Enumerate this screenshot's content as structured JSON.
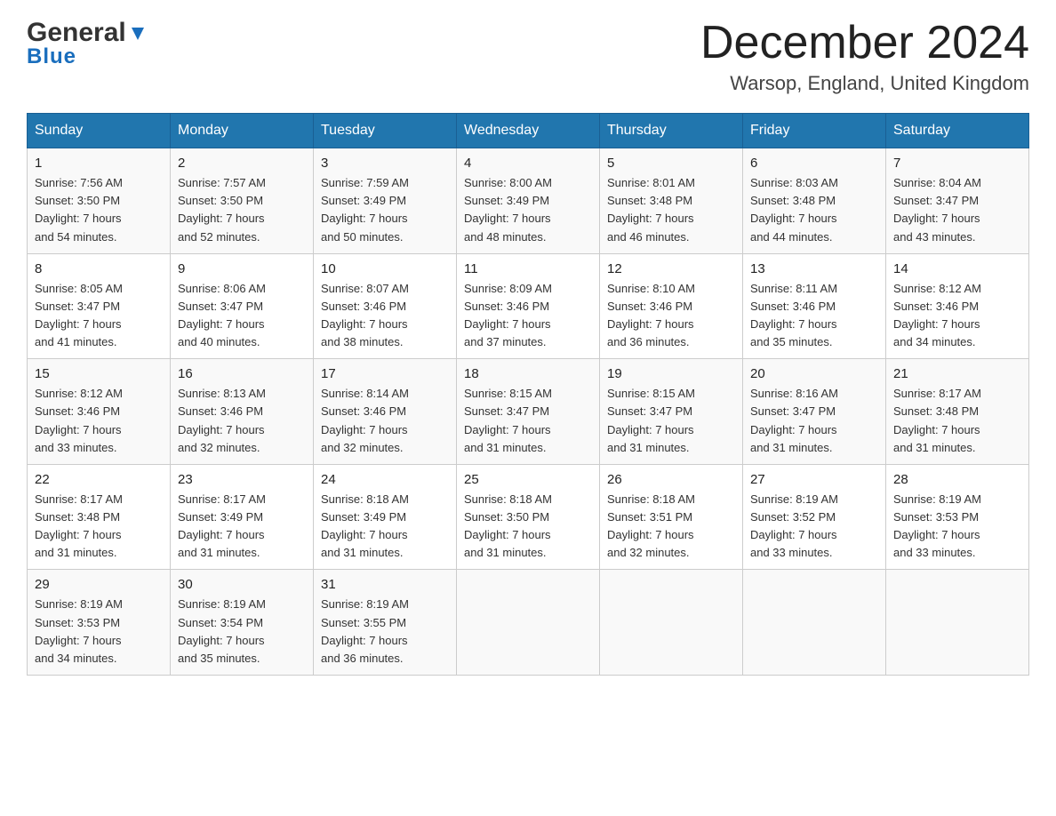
{
  "header": {
    "logo_general": "General",
    "logo_blue": "Blue",
    "month_title": "December 2024",
    "location": "Warsop, England, United Kingdom"
  },
  "weekdays": [
    "Sunday",
    "Monday",
    "Tuesday",
    "Wednesday",
    "Thursday",
    "Friday",
    "Saturday"
  ],
  "weeks": [
    [
      {
        "day": "1",
        "sunrise": "7:56 AM",
        "sunset": "3:50 PM",
        "daylight": "7 hours and 54 minutes."
      },
      {
        "day": "2",
        "sunrise": "7:57 AM",
        "sunset": "3:50 PM",
        "daylight": "7 hours and 52 minutes."
      },
      {
        "day": "3",
        "sunrise": "7:59 AM",
        "sunset": "3:49 PM",
        "daylight": "7 hours and 50 minutes."
      },
      {
        "day": "4",
        "sunrise": "8:00 AM",
        "sunset": "3:49 PM",
        "daylight": "7 hours and 48 minutes."
      },
      {
        "day": "5",
        "sunrise": "8:01 AM",
        "sunset": "3:48 PM",
        "daylight": "7 hours and 46 minutes."
      },
      {
        "day": "6",
        "sunrise": "8:03 AM",
        "sunset": "3:48 PM",
        "daylight": "7 hours and 44 minutes."
      },
      {
        "day": "7",
        "sunrise": "8:04 AM",
        "sunset": "3:47 PM",
        "daylight": "7 hours and 43 minutes."
      }
    ],
    [
      {
        "day": "8",
        "sunrise": "8:05 AM",
        "sunset": "3:47 PM",
        "daylight": "7 hours and 41 minutes."
      },
      {
        "day": "9",
        "sunrise": "8:06 AM",
        "sunset": "3:47 PM",
        "daylight": "7 hours and 40 minutes."
      },
      {
        "day": "10",
        "sunrise": "8:07 AM",
        "sunset": "3:46 PM",
        "daylight": "7 hours and 38 minutes."
      },
      {
        "day": "11",
        "sunrise": "8:09 AM",
        "sunset": "3:46 PM",
        "daylight": "7 hours and 37 minutes."
      },
      {
        "day": "12",
        "sunrise": "8:10 AM",
        "sunset": "3:46 PM",
        "daylight": "7 hours and 36 minutes."
      },
      {
        "day": "13",
        "sunrise": "8:11 AM",
        "sunset": "3:46 PM",
        "daylight": "7 hours and 35 minutes."
      },
      {
        "day": "14",
        "sunrise": "8:12 AM",
        "sunset": "3:46 PM",
        "daylight": "7 hours and 34 minutes."
      }
    ],
    [
      {
        "day": "15",
        "sunrise": "8:12 AM",
        "sunset": "3:46 PM",
        "daylight": "7 hours and 33 minutes."
      },
      {
        "day": "16",
        "sunrise": "8:13 AM",
        "sunset": "3:46 PM",
        "daylight": "7 hours and 32 minutes."
      },
      {
        "day": "17",
        "sunrise": "8:14 AM",
        "sunset": "3:46 PM",
        "daylight": "7 hours and 32 minutes."
      },
      {
        "day": "18",
        "sunrise": "8:15 AM",
        "sunset": "3:47 PM",
        "daylight": "7 hours and 31 minutes."
      },
      {
        "day": "19",
        "sunrise": "8:15 AM",
        "sunset": "3:47 PM",
        "daylight": "7 hours and 31 minutes."
      },
      {
        "day": "20",
        "sunrise": "8:16 AM",
        "sunset": "3:47 PM",
        "daylight": "7 hours and 31 minutes."
      },
      {
        "day": "21",
        "sunrise": "8:17 AM",
        "sunset": "3:48 PM",
        "daylight": "7 hours and 31 minutes."
      }
    ],
    [
      {
        "day": "22",
        "sunrise": "8:17 AM",
        "sunset": "3:48 PM",
        "daylight": "7 hours and 31 minutes."
      },
      {
        "day": "23",
        "sunrise": "8:17 AM",
        "sunset": "3:49 PM",
        "daylight": "7 hours and 31 minutes."
      },
      {
        "day": "24",
        "sunrise": "8:18 AM",
        "sunset": "3:49 PM",
        "daylight": "7 hours and 31 minutes."
      },
      {
        "day": "25",
        "sunrise": "8:18 AM",
        "sunset": "3:50 PM",
        "daylight": "7 hours and 31 minutes."
      },
      {
        "day": "26",
        "sunrise": "8:18 AM",
        "sunset": "3:51 PM",
        "daylight": "7 hours and 32 minutes."
      },
      {
        "day": "27",
        "sunrise": "8:19 AM",
        "sunset": "3:52 PM",
        "daylight": "7 hours and 33 minutes."
      },
      {
        "day": "28",
        "sunrise": "8:19 AM",
        "sunset": "3:53 PM",
        "daylight": "7 hours and 33 minutes."
      }
    ],
    [
      {
        "day": "29",
        "sunrise": "8:19 AM",
        "sunset": "3:53 PM",
        "daylight": "7 hours and 34 minutes."
      },
      {
        "day": "30",
        "sunrise": "8:19 AM",
        "sunset": "3:54 PM",
        "daylight": "7 hours and 35 minutes."
      },
      {
        "day": "31",
        "sunrise": "8:19 AM",
        "sunset": "3:55 PM",
        "daylight": "7 hours and 36 minutes."
      },
      null,
      null,
      null,
      null
    ]
  ],
  "labels": {
    "sunrise": "Sunrise:",
    "sunset": "Sunset:",
    "daylight": "Daylight:"
  }
}
